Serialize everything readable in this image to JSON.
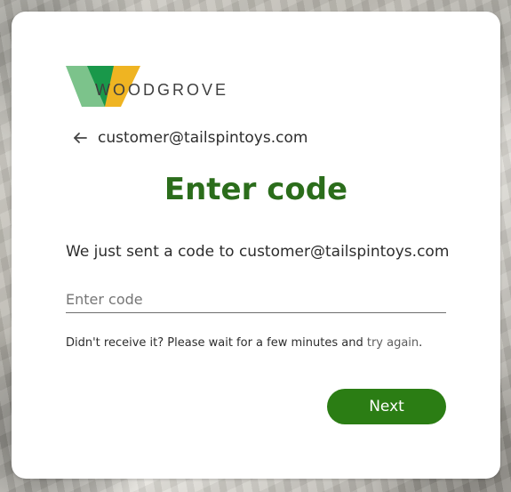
{
  "brand": {
    "logo_text": "WOODGROVE",
    "logo_colors": {
      "left": "#7cc38b",
      "middle": "#19984a",
      "right": "#efb422"
    }
  },
  "identity": {
    "icon": "back-arrow-icon",
    "email": "customer@tailspintoys.com"
  },
  "page": {
    "title": "Enter code",
    "description": "We just sent a code to customer@tailspintoys.com",
    "title_color": "#2b6d1b"
  },
  "form": {
    "code_value": "",
    "code_placeholder": "Enter code",
    "hint_prefix": "Didn't receive it? Please wait for a few minutes and ",
    "retry_label": "try again",
    "hint_suffix": ".",
    "next_label": "Next",
    "button_color": "#2b7d14"
  }
}
